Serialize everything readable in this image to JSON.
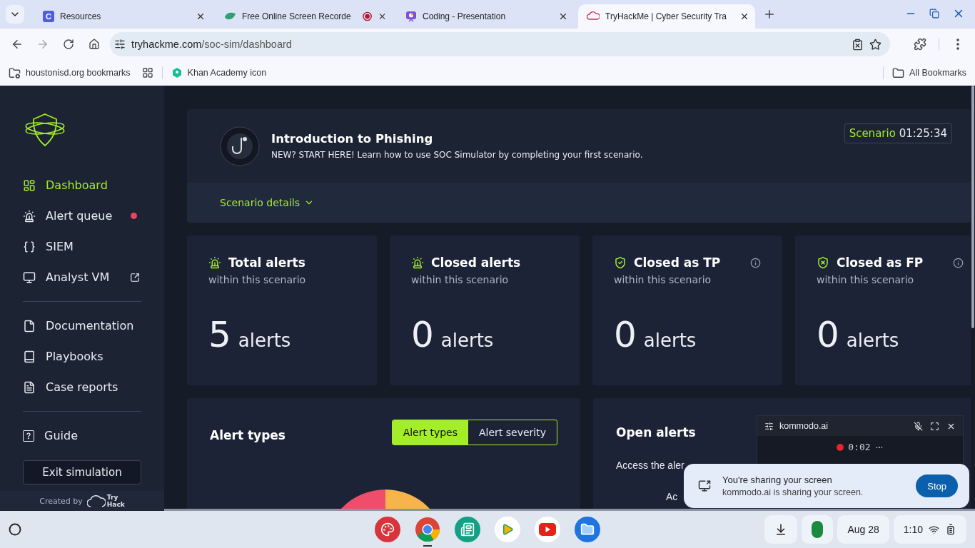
{
  "browser": {
    "tabs": [
      {
        "title": "Resources",
        "selected": false,
        "kind": "letter",
        "icon_letter": "C",
        "recording": false
      },
      {
        "title": "Free Online Screen Recorde",
        "selected": false,
        "kind": "leaf",
        "recording": true
      },
      {
        "title": "Coding - Presentation",
        "selected": false,
        "kind": "slides",
        "recording": false
      },
      {
        "title": "TryHackMe | Cyber Security Tra",
        "selected": true,
        "kind": "cloud",
        "recording": false
      }
    ],
    "url_host": "tryhackme.com",
    "url_path": "/soc-sim/dashboard",
    "bookmarks": [
      {
        "label": "houstonisd.org bookmarks",
        "kind": "folder"
      },
      {
        "label": "Khan Academy icon",
        "kind": "khan"
      }
    ],
    "all_bookmarks": "All Bookmarks"
  },
  "sidebar": {
    "groups": [
      [
        {
          "label": "Dashboard",
          "selected": true,
          "kind": "dashboard",
          "alert_dot": false,
          "external": false
        },
        {
          "label": "Alert queue",
          "selected": false,
          "kind": "siren",
          "alert_dot": true,
          "external": false
        },
        {
          "label": "SIEM",
          "selected": false,
          "kind": "braces",
          "alert_dot": false,
          "external": false
        },
        {
          "label": "Analyst VM",
          "selected": false,
          "kind": "monitor",
          "alert_dot": false,
          "external": true
        }
      ],
      [
        {
          "label": "Documentation",
          "selected": false,
          "kind": "file",
          "alert_dot": false,
          "external": false
        },
        {
          "label": "Playbooks",
          "selected": false,
          "kind": "book",
          "alert_dot": false,
          "external": false
        },
        {
          "label": "Case reports",
          "selected": false,
          "kind": "report",
          "alert_dot": false,
          "external": false
        }
      ],
      [
        {
          "label": "Guide",
          "selected": false,
          "kind": "help",
          "alert_dot": false,
          "external": false
        }
      ]
    ],
    "exit_button": "Exit simulation",
    "created_by": "Created by",
    "brand_line1": "Try",
    "brand_line2": "Hack"
  },
  "scenario": {
    "title": "Introduction to Phishing",
    "description": "NEW? START HERE! Learn how to use SOC Simulator by completing your first scenario.",
    "timer_label": "Scenario",
    "timer": "01:25:34",
    "details_link": "Scenario details"
  },
  "stats": [
    {
      "title": "Total alerts",
      "subtitle": "within this scenario",
      "value": "5",
      "unit": "alerts",
      "kind": "siren",
      "info": false
    },
    {
      "title": "Closed alerts",
      "subtitle": "within this scenario",
      "value": "0",
      "unit": "alerts",
      "kind": "siren",
      "info": false
    },
    {
      "title": "Closed as TP",
      "subtitle": "within this scenario",
      "value": "0",
      "unit": "alerts",
      "kind": "shield-check",
      "info": true
    },
    {
      "title": "Closed as FP",
      "subtitle": "within this scenario",
      "value": "0",
      "unit": "alerts",
      "kind": "shield-x",
      "info": true
    }
  ],
  "alert_types": {
    "title": "Alert types",
    "toggle": [
      {
        "label": "Alert types",
        "selected": true
      },
      {
        "label": "Alert severity",
        "selected": false
      }
    ]
  },
  "open_alerts": {
    "title": "Open alerts",
    "text": "Access the aler",
    "text_2": "Ac"
  },
  "recorder": {
    "title": "kommodo.ai",
    "timer": "0:02"
  },
  "share_notice": {
    "title": "You're sharing your screen",
    "text": "kommodo.ai is sharing your screen.",
    "button": "Stop"
  },
  "taskbar": {
    "apps": [
      {
        "kind": "palette",
        "active": false
      },
      {
        "kind": "chrome",
        "active": true
      },
      {
        "kind": "news",
        "active": false
      },
      {
        "kind": "play",
        "active": false
      },
      {
        "kind": "youtube",
        "active": false
      },
      {
        "kind": "files",
        "active": false
      }
    ],
    "date": "Aug 28",
    "time": "1:10"
  }
}
